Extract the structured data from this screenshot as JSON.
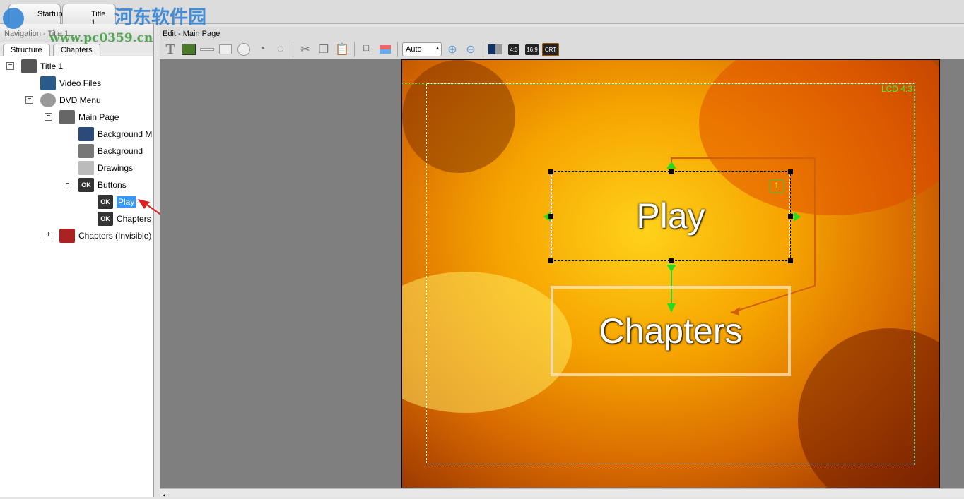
{
  "top_tabs": [
    {
      "label": "Startup"
    },
    {
      "label": "Title 1"
    }
  ],
  "navigation": {
    "title": "Navigation - Title 1",
    "tabs": [
      "Structure",
      "Chapters"
    ]
  },
  "tree": {
    "title": "Title 1",
    "video_files": "Video Files",
    "dvd_menu": "DVD Menu",
    "main_page": "Main Page",
    "background_music": "Background M",
    "background": "Background",
    "drawings": "Drawings",
    "buttons": "Buttons",
    "play": "Play",
    "chapters": "Chapters",
    "chapters_invisible": "Chapters (Invisible)",
    "ok": "OK"
  },
  "editor": {
    "title": "Edit - Main Page",
    "zoom": "Auto",
    "ratio_43": "4:3",
    "ratio_169": "16:9",
    "crt": "CRT"
  },
  "canvas": {
    "lcd_label": "LCD 4:3",
    "play_label": "Play",
    "chapters_label": "Chapters",
    "button_number": "1"
  },
  "watermark": {
    "cn": "河东软件园",
    "url": "www.pc0359.cn"
  }
}
